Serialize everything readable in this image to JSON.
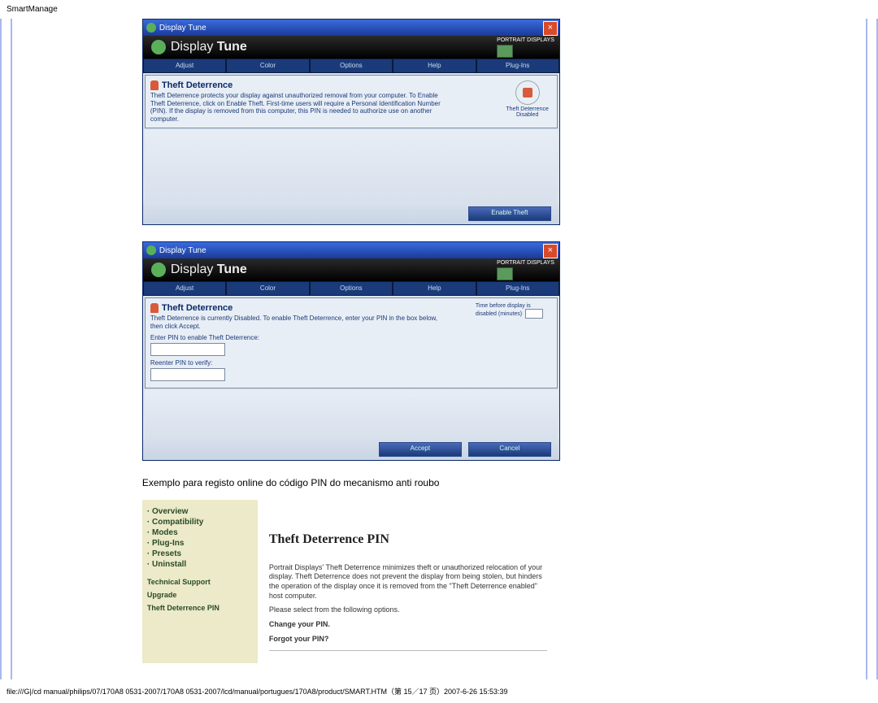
{
  "page_header": "SmartManage",
  "window1": {
    "title": "Display Tune",
    "brand": {
      "part1": "Display ",
      "part2": "Tune"
    },
    "brand_right": "PORTRAIT DISPLAYS",
    "tabs": [
      "Adjust",
      "Color",
      "Options",
      "Help",
      "Plug-Ins"
    ],
    "section_title": "Theft Deterrence",
    "desc": "Theft Deterrence protects your display against unauthorized removal from your computer. To Enable Theft Deterrence, click on Enable Theft. First-time users will require a Personal Identification Number (PIN). If the display is removed from this computer, this PIN is needed to authorize use on another computer.",
    "sidebadge_line1": "Theft Deterrence",
    "sidebadge_line2": "Disabled",
    "button": "Enable Theft"
  },
  "window2": {
    "title": "Display Tune",
    "brand": {
      "part1": "Display ",
      "part2": "Tune"
    },
    "brand_right": "PORTRAIT DISPLAYS",
    "tabs": [
      "Adjust",
      "Color",
      "Options",
      "Help",
      "Plug-Ins"
    ],
    "section_title": "Theft Deterrence",
    "desc": "Theft Deterrence is currently Disabled. To enable Theft Deterrence, enter your PIN in the box below, then click Accept.",
    "time_note": "Time before display is disabled (minutes)",
    "field1": "Enter PIN to enable Theft Deterrence:",
    "field2": "Reenter PIN to verify:",
    "btn1": "Accept",
    "btn2": "Cancel"
  },
  "caption": "Exemplo para registo online do código PIN do mecanismo anti roubo",
  "web": {
    "nav": [
      "Overview",
      "Compatibility",
      "Modes",
      "Plug-Ins",
      "Presets",
      "Uninstall"
    ],
    "minor1": "Technical Support",
    "minor2": "Upgrade",
    "minor3": "Theft Deterrence PIN",
    "heading": "Theft Deterrence PIN",
    "para1": "Portrait Displays' Theft Deterrence minimizes theft or unauthorized relocation of your display. Theft Deterrence does not prevent the display from being stolen, but hinders the operation of the display once it is removed from the \"Theft Deterrence enabled\" host computer.",
    "para2": "Please select from the following options.",
    "link1": "Change your PIN.",
    "link2": "Forgot your PIN?"
  },
  "footer": "file:///G|/cd manual/philips/07/170A8 0531-2007/170A8 0531-2007/lcd/manual/portugues/170A8/product/SMART.HTM（第 15／17 页）2007-6-26 15:53:39"
}
